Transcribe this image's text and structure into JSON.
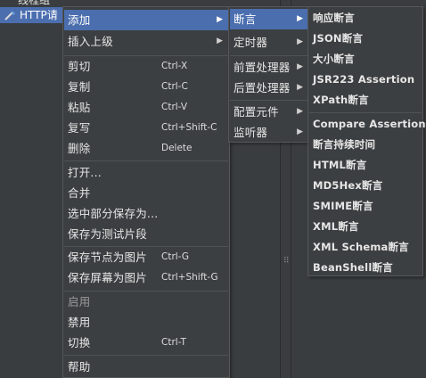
{
  "background": {
    "tree_items": [
      {
        "label": "线程组"
      },
      {
        "label": "HTTP请"
      }
    ]
  },
  "context_menu": {
    "items": [
      {
        "label": "添加",
        "shortcut": "",
        "submenu": true
      },
      {
        "label": "插入上级",
        "shortcut": "",
        "submenu": true
      },
      {
        "label": "剪切",
        "shortcut": "Ctrl-X"
      },
      {
        "label": "复制",
        "shortcut": "Ctrl-C"
      },
      {
        "label": "粘贴",
        "shortcut": "Ctrl-V"
      },
      {
        "label": "复写",
        "shortcut": "Ctrl+Shift-C"
      },
      {
        "label": "删除",
        "shortcut": "Delete"
      },
      {
        "label": "打开..."
      },
      {
        "label": "合并"
      },
      {
        "label": "选中部分保存为..."
      },
      {
        "label": "保存为测试片段"
      },
      {
        "label": "保存节点为图片",
        "shortcut": "Ctrl-G"
      },
      {
        "label": "保存屏幕为图片",
        "shortcut": "Ctrl+Shift-G"
      },
      {
        "label": "启用"
      },
      {
        "label": "禁用"
      },
      {
        "label": "切换",
        "shortcut": "Ctrl-T"
      },
      {
        "label": "帮助"
      }
    ]
  },
  "add_submenu": {
    "items": [
      {
        "label": "断言"
      },
      {
        "label": "定时器"
      },
      {
        "label": "前置处理器"
      },
      {
        "label": "后置处理器"
      },
      {
        "label": "配置元件"
      },
      {
        "label": "监听器"
      }
    ]
  },
  "assertion_submenu": {
    "items": [
      {
        "label": "响应断言"
      },
      {
        "label": "JSON断言"
      },
      {
        "label": "大小断言"
      },
      {
        "label": "JSR223 Assertion"
      },
      {
        "label": "XPath断言"
      },
      {
        "label": "Compare Assertion"
      },
      {
        "label": "断言持续时间"
      },
      {
        "label": "HTML断言"
      },
      {
        "label": "MD5Hex断言"
      },
      {
        "label": "SMIME断言"
      },
      {
        "label": "XML断言"
      },
      {
        "label": "XML Schema断言"
      },
      {
        "label": "BeanShell断言"
      }
    ]
  },
  "colors": {
    "menu_bg": "#3c3f41",
    "highlight": "#4b6eaf",
    "text": "#e6e6e6",
    "disabled_text": "#9a9a9a"
  }
}
